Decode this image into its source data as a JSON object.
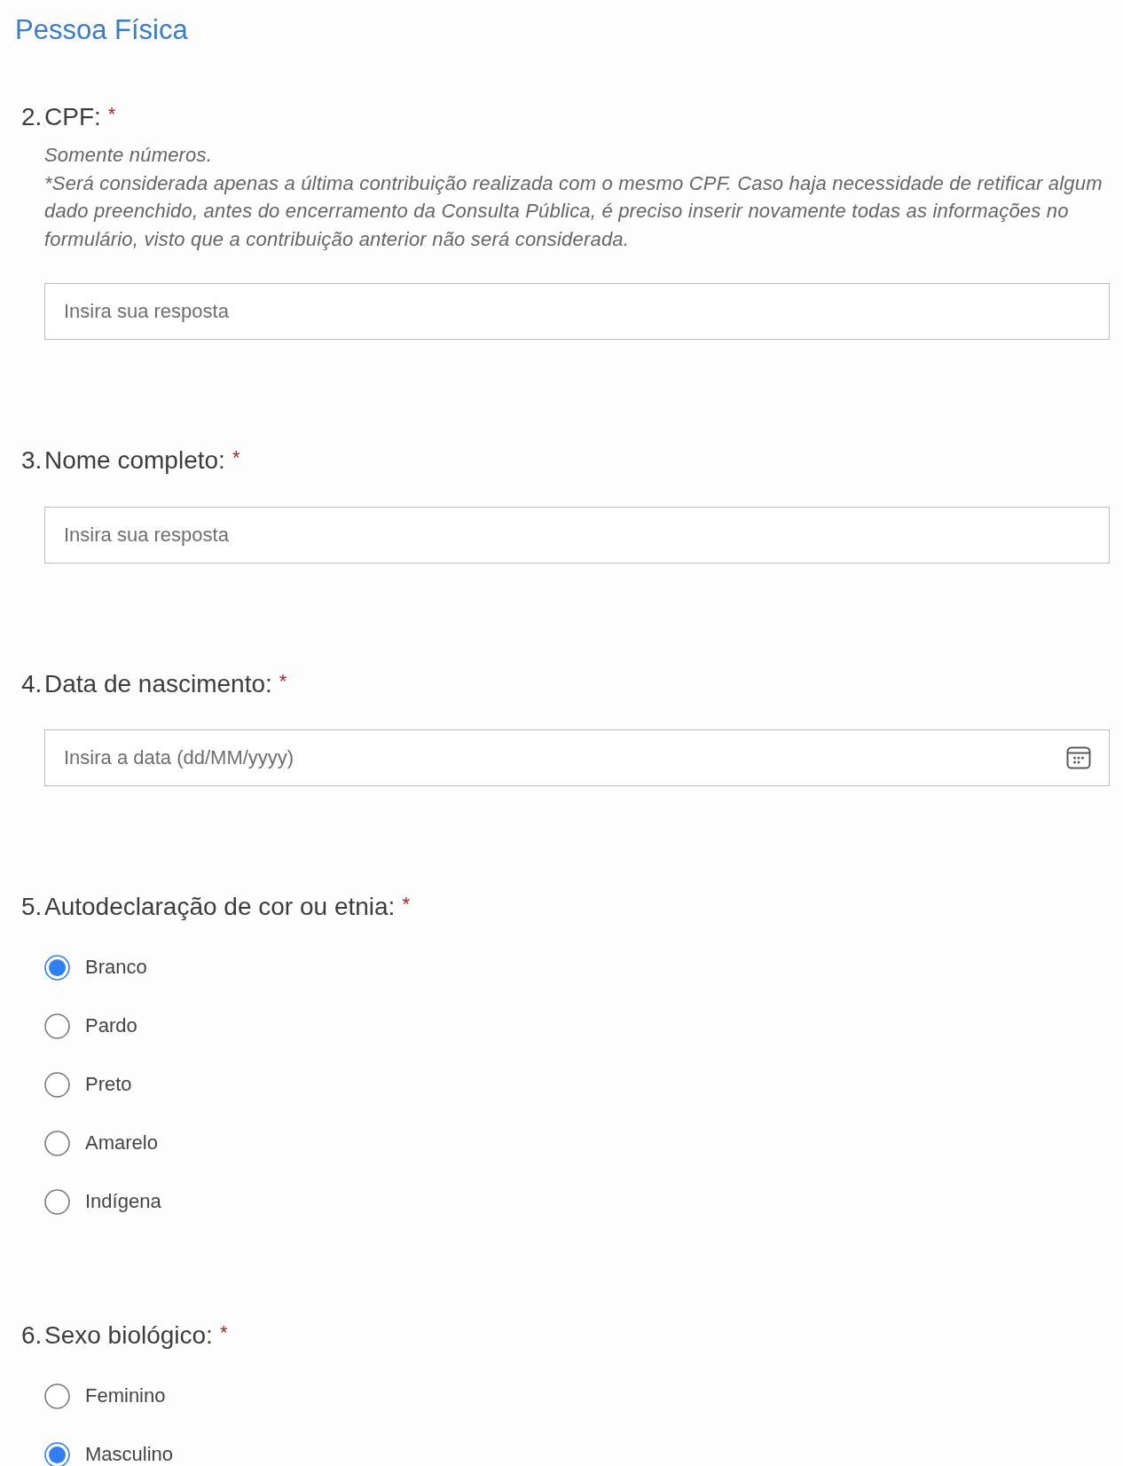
{
  "section_title": "Pessoa Física",
  "questions": [
    {
      "kind": "text",
      "number": "2.",
      "title": "CPF:",
      "required_mark": "*",
      "description": [
        "Somente números.",
        "*Será considerada apenas a última contribuição realizada com o mesmo CPF. Caso haja necessidade de retificar algum dado preenchido, antes do encerramento da Consulta Pública, é preciso inserir novamente todas as informações no formulário, visto que a contribuição anterior não será considerada."
      ],
      "placeholder": "Insira sua resposta"
    },
    {
      "kind": "text",
      "number": "3.",
      "title": "Nome completo:",
      "required_mark": "*",
      "placeholder": "Insira sua resposta"
    },
    {
      "kind": "date",
      "number": "4.",
      "title": "Data de nascimento:",
      "required_mark": "*",
      "placeholder": "Insira a data (dd/MM/yyyy)"
    },
    {
      "kind": "choice",
      "number": "5.",
      "title": "Autodeclaração de cor ou etnia:",
      "required_mark": "*",
      "options": [
        {
          "label": "Branco",
          "selected": true
        },
        {
          "label": "Pardo",
          "selected": false
        },
        {
          "label": "Preto",
          "selected": false
        },
        {
          "label": "Amarelo",
          "selected": false
        },
        {
          "label": "Indígena",
          "selected": false
        }
      ]
    },
    {
      "kind": "choice",
      "number": "6.",
      "title": "Sexo biológico:",
      "required_mark": "*",
      "options": [
        {
          "label": "Feminino",
          "selected": false
        },
        {
          "label": "Masculino",
          "selected": true
        }
      ]
    }
  ]
}
